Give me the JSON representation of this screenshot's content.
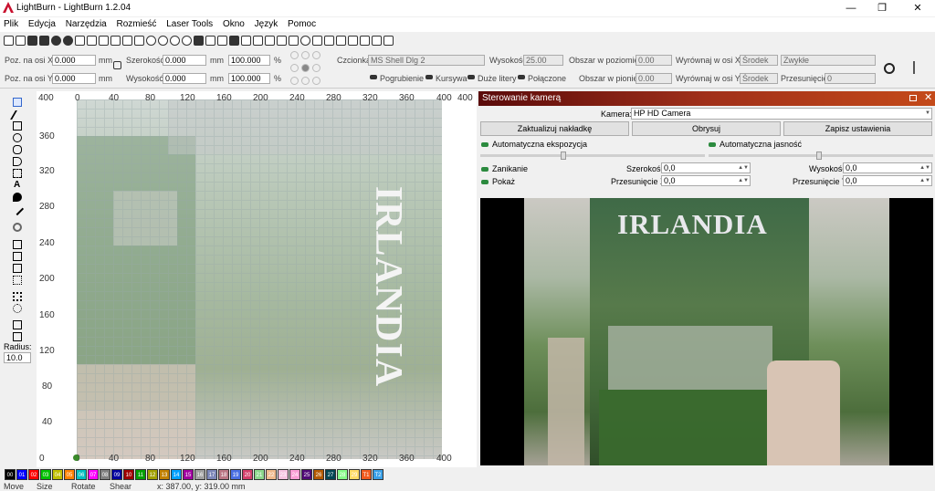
{
  "app": {
    "title": "LightBurn - LightBurn 1.2.04"
  },
  "window_controls": {
    "minimize": "—",
    "maximize": "❐",
    "close": "✕"
  },
  "menu": [
    "Plik",
    "Edycja",
    "Narzędzia",
    "Rozmieść",
    "Laser Tools",
    "Okno",
    "Język",
    "Pomoc"
  ],
  "props": {
    "pos_x_label": "Poz. na osi X",
    "pos_x_value": "0.000",
    "pos_y_label": "Poz. na osi Y",
    "pos_y_value": "0.000",
    "unit": "mm",
    "width_label": "Szerokość",
    "width_value": "0.000",
    "height_label": "Wysokość",
    "height_value": "0.000",
    "scale_x": "100.000",
    "scale_y": "100.000",
    "percent": "%",
    "font_label": "Czcionka",
    "font_value": "MS Shell Dlg 2",
    "font_height_label": "Wysokość",
    "font_height_value": "25.00",
    "hspace_label": "Obszar w poziomie",
    "hspace_value": "0.00",
    "vspace_label": "Obszar w pionie",
    "vspace_value": "0.00",
    "align_x_label": "Wyrównaj w osi X",
    "align_x_value": "Środek",
    "align_y_label": "Wyrównaj w osi Y",
    "align_y_value": "Środek",
    "style_value": "Zwykłe",
    "offset_label": "Przesunięcie",
    "offset_value": "0",
    "bold": "Pogrubienie",
    "italic": "Kursywa",
    "caps": "Duże litery",
    "welded": "Połączone"
  },
  "left_tools": {
    "radius_label": "Radius:",
    "radius_value": "10.0"
  },
  "ruler": {
    "top": [
      "0",
      "40",
      "80",
      "120",
      "160",
      "200",
      "240",
      "280",
      "320",
      "360",
      "400"
    ],
    "side": [
      "400",
      "360",
      "320",
      "280",
      "240",
      "200",
      "160",
      "120",
      "80",
      "40",
      "0"
    ],
    "bottom": [
      "0",
      "40",
      "80",
      "120",
      "160",
      "200",
      "240",
      "280",
      "320",
      "360",
      "400"
    ]
  },
  "bed_text": "IRLANDIA",
  "camera": {
    "title": "Sterowanie kamerą",
    "camera_label": "Kamera:",
    "camera_value": "HP HD Camera",
    "update_overlay": "Zaktualizuj nakładkę",
    "trace": "Obrysuj",
    "save_settings": "Zapisz ustawienia",
    "auto_exposure": "Automatyczna ekspozycja",
    "auto_brightness": "Automatyczna jasność",
    "fade": "Zanikanie",
    "show": "Pokaż",
    "width_label": "Szerokość",
    "width_value": "0,0",
    "height_label": "Wysokość",
    "height_value": "0,0",
    "offset_x_label": "Przesunięcie X",
    "offset_x_value": "0,0",
    "offset_y_label": "Przesunięcie Y",
    "offset_y_value": "0,0",
    "book_title": "IRLANDIA"
  },
  "palette": [
    {
      "id": "00",
      "color": "#000000"
    },
    {
      "id": "01",
      "color": "#0000ff"
    },
    {
      "id": "02",
      "color": "#ff0000"
    },
    {
      "id": "03",
      "color": "#00c000"
    },
    {
      "id": "04",
      "color": "#c0c000"
    },
    {
      "id": "05",
      "color": "#ff8000"
    },
    {
      "id": "06",
      "color": "#00c0c0"
    },
    {
      "id": "07",
      "color": "#ff00ff"
    },
    {
      "id": "08",
      "color": "#808080"
    },
    {
      "id": "09",
      "color": "#0000a0"
    },
    {
      "id": "10",
      "color": "#a00000"
    },
    {
      "id": "11",
      "color": "#00a000"
    },
    {
      "id": "12",
      "color": "#a0a000"
    },
    {
      "id": "13",
      "color": "#c08000"
    },
    {
      "id": "14",
      "color": "#00a0ff"
    },
    {
      "id": "15",
      "color": "#a000a0"
    },
    {
      "id": "16",
      "color": "#a0a0a0"
    },
    {
      "id": "17",
      "color": "#7d87b9"
    },
    {
      "id": "18",
      "color": "#bb7784"
    },
    {
      "id": "19",
      "color": "#4a6fe3"
    },
    {
      "id": "20",
      "color": "#d33f6a"
    },
    {
      "id": "21",
      "color": "#8cd78c"
    },
    {
      "id": "22",
      "color": "#f0b98d"
    },
    {
      "id": "23",
      "color": "#f6c4e1"
    },
    {
      "id": "24",
      "color": "#fa9ed4"
    },
    {
      "id": "25",
      "color": "#500a78"
    },
    {
      "id": "26",
      "color": "#b45a00"
    },
    {
      "id": "27",
      "color": "#004754"
    },
    {
      "id": "28",
      "color": "#86fa88"
    },
    {
      "id": "29",
      "color": "#ffdb66"
    },
    {
      "id": "T1",
      "color": "#f05a1e"
    },
    {
      "id": "T2",
      "color": "#3aa0e8"
    }
  ],
  "status": {
    "move": "Move",
    "size": "Size",
    "rotate": "Rotate",
    "shear": "Shear",
    "coords": "x: 387.00, y: 319.00 mm"
  }
}
